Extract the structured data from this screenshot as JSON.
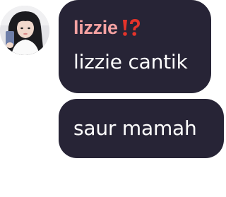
{
  "avatar": {
    "icon": "user-photo-avatar"
  },
  "messages": [
    {
      "sender": "lizzie",
      "sender_badge_icon": "exclamation-question-mark-emoji",
      "text": "lizzie cantik"
    },
    {
      "text": "saur mamah"
    }
  ],
  "colors": {
    "bubble_background": "#272436",
    "message_text": "#ffffff",
    "sender_name": "#f6a2a2",
    "badge": "#e5332a"
  }
}
